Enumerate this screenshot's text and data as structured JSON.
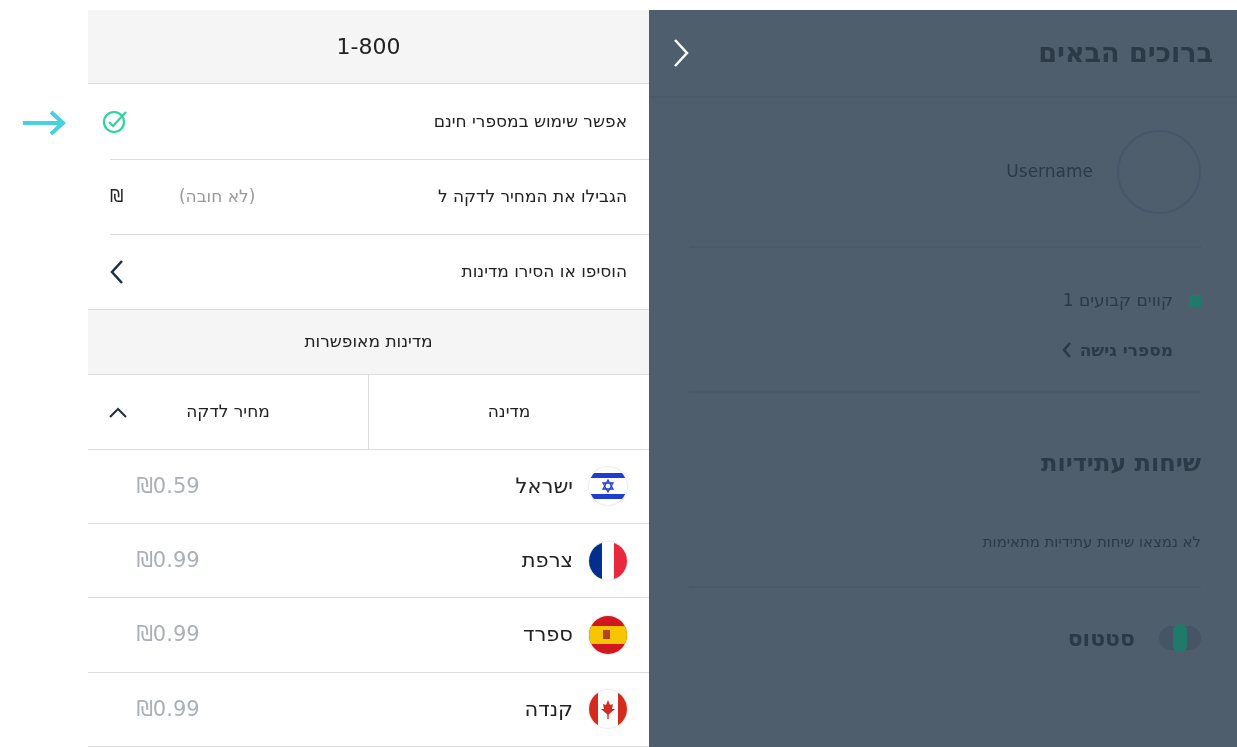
{
  "panel": {
    "header": "1-800",
    "settings": [
      {
        "kind": "check",
        "label": "אפשר שימוש במספרי חינם",
        "checked": true
      },
      {
        "kind": "price_limit",
        "label": "הגבילו את המחיר לדקה ל",
        "placeholder": "(לא חובה)",
        "currency": "₪"
      },
      {
        "kind": "link",
        "label": "הוסיפו או הסירו מדינות"
      }
    ],
    "countries": {
      "title": "מדינות מאופשרות",
      "columns": [
        {
          "label": "מדינה",
          "sorted": false
        },
        {
          "label": "מחיר לדקה",
          "sorted": true
        }
      ],
      "rows": [
        {
          "kind": "il",
          "name": "ישראל",
          "price": "₪0.59"
        },
        {
          "kind": "fr",
          "name": "צרפת",
          "price": "₪0.99"
        },
        {
          "kind": "es",
          "name": "ספרד",
          "price": "₪0.99"
        },
        {
          "kind": "ca",
          "name": "קנדה",
          "price": "₪0.99"
        }
      ]
    }
  },
  "background_page": {
    "title": "ברוכים הבאים",
    "username": "Username",
    "lines": {
      "label": "קווים קבועים 1",
      "color": "#1f7a6c"
    },
    "access_numbers": "מספרי גישה",
    "future_calls_title": "שיחות עתידיות",
    "future_calls_empty": "לא נמצאו שיחות עתידיות מתאימות",
    "status": {
      "label": "סטטוס",
      "on": true
    }
  }
}
